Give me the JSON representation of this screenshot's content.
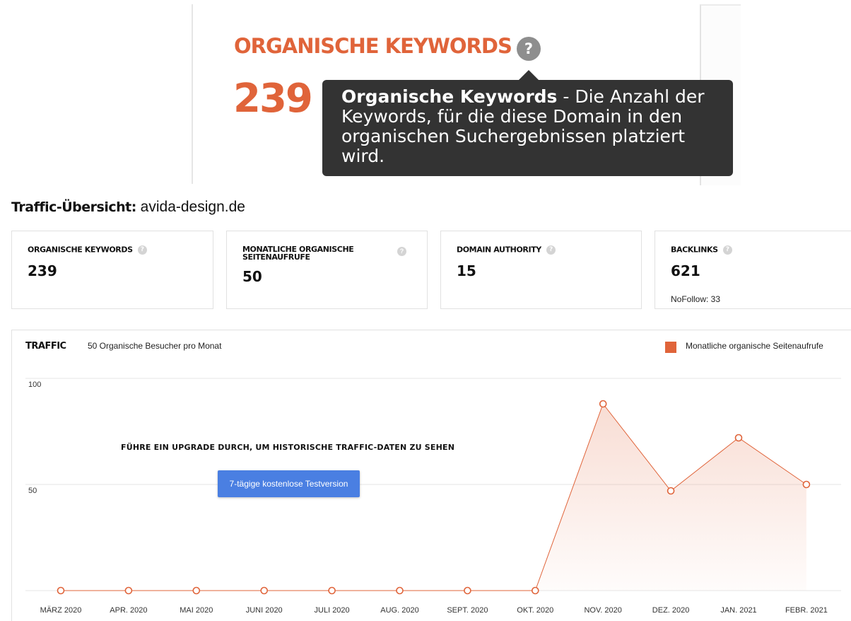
{
  "zoom": {
    "title": "ORGANISCHE KEYWORDS",
    "help_glyph": "?",
    "value": "239",
    "tooltip_term": "Organische Keywords",
    "tooltip_text": " - Die Anzahl der Keywords, für die diese Domain in den organischen Suchergebnissen platziert wird."
  },
  "overview": {
    "title_bold": "Traffic-Übersicht:",
    "domain": " avida-design.de"
  },
  "cards": [
    {
      "label": "ORGANISCHE KEYWORDS",
      "value": "239",
      "sub": ""
    },
    {
      "label": "MONATLICHE ORGANISCHE SEITENAUFRUFE",
      "value": "50",
      "sub": ""
    },
    {
      "label": "DOMAIN AUTHORITY",
      "value": "15",
      "sub": ""
    },
    {
      "label": "BACKLINKS",
      "value": "621",
      "sub": "NoFollow: 33"
    }
  ],
  "card_help_glyph": "?",
  "traffic": {
    "label": "TRAFFIC",
    "subtitle": "50 Organische Besucher pro Monat",
    "legend": "Monatliche organische Seitenaufrufe",
    "upgrade_text": "FÜHRE EIN UPGRADE DURCH, UM HISTORISCHE TRAFFIC-DATEN ZU SEHEN",
    "trial_button": "7-tägige kostenlose Testversion"
  },
  "colors": {
    "accent": "#e0643a",
    "button": "#4a7fe2",
    "tooltip_bg": "#333333"
  },
  "chart_data": {
    "type": "area",
    "categories": [
      "MÄRZ 2020",
      "APR. 2020",
      "MAI 2020",
      "JUNI 2020",
      "JULI 2020",
      "AUG. 2020",
      "SEPT. 2020",
      "OKT. 2020",
      "NOV. 2020",
      "DEZ. 2020",
      "JAN. 2021",
      "FEBR. 2021"
    ],
    "series": [
      {
        "name": "Monatliche organische Seitenaufrufe",
        "values": [
          0,
          0,
          0,
          0,
          0,
          0,
          0,
          0,
          88,
          47,
          72,
          50
        ]
      }
    ],
    "ylim": [
      0,
      100
    ],
    "yticks": [
      50,
      100
    ],
    "grid": true,
    "legend": "top-right"
  }
}
